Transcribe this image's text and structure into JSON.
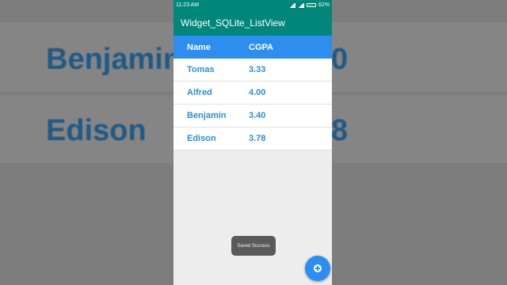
{
  "background": {
    "row1_name": "Benjamin",
    "row1_right": "0",
    "row2_name": "Edison",
    "row2_right": "8"
  },
  "status_bar": {
    "time": "11:23 AM",
    "battery_text": "62%"
  },
  "app_bar": {
    "title": "Widget_SQLite_ListView"
  },
  "table": {
    "headers": {
      "name": "Name",
      "cgpa": "CGPA"
    },
    "rows": [
      {
        "name": "Tomas",
        "cgpa": "3.33"
      },
      {
        "name": "Alfred",
        "cgpa": "4.00"
      },
      {
        "name": "Benjamin",
        "cgpa": "3.40"
      },
      {
        "name": "Edison",
        "cgpa": "3.78"
      }
    ]
  },
  "toast": {
    "text": "Saved Success"
  },
  "fab": {
    "icon": "add-circle-icon"
  },
  "colors": {
    "primary": "#00877a",
    "accent": "#2d8ef0",
    "text_blue": "#2a8fd4"
  }
}
